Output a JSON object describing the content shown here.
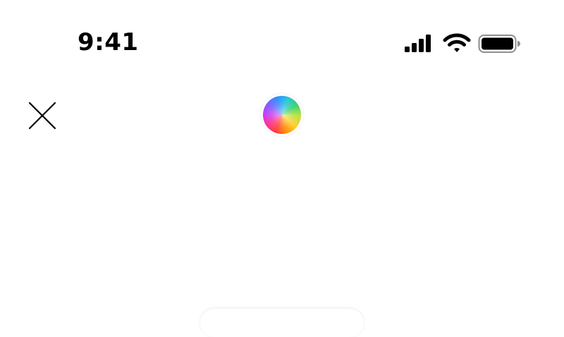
{
  "status_bar": {
    "time": "9:41",
    "icons": [
      "cellular-signal-icon",
      "wifi-icon",
      "battery-icon"
    ],
    "battery_level": 1.0
  },
  "toolbar": {
    "close_icon": "close-icon",
    "color_picker_icon": "color-wheel-icon"
  },
  "colors": {
    "background": "#ffffff",
    "foreground": "#000000"
  }
}
